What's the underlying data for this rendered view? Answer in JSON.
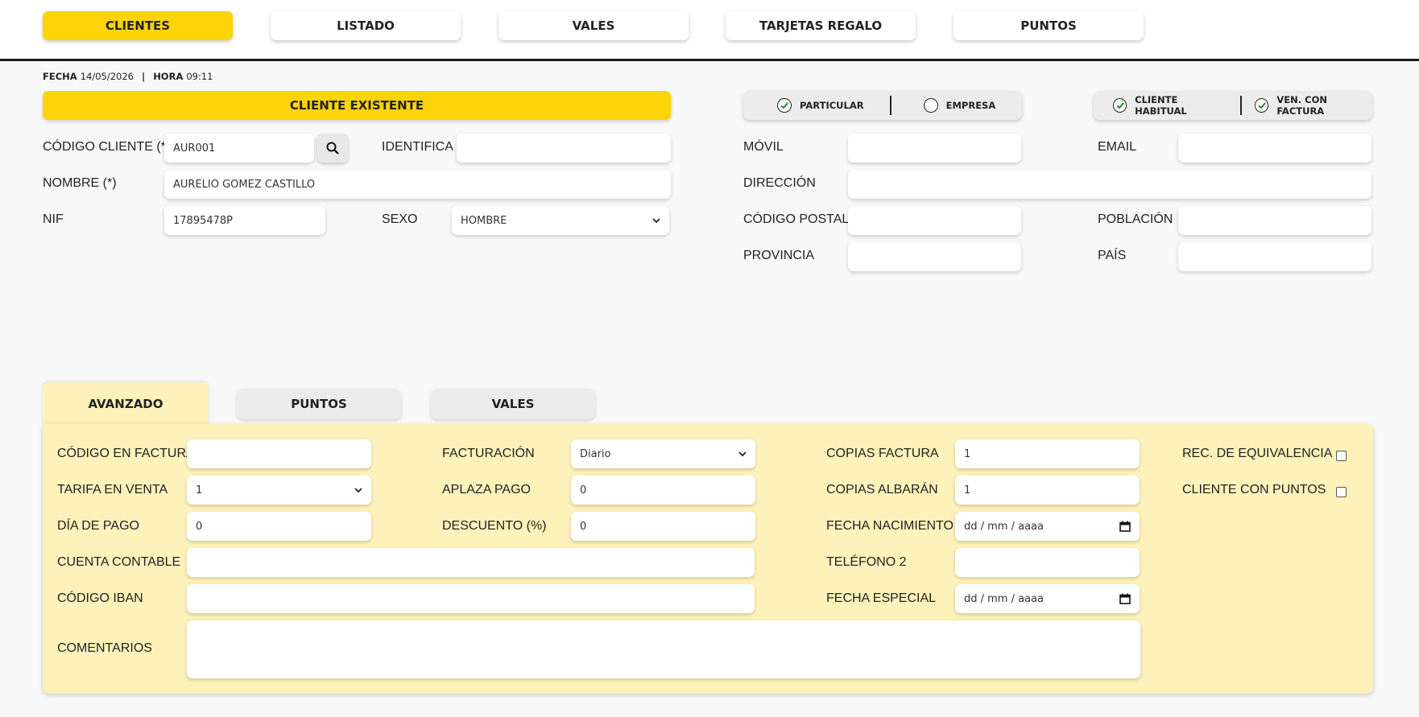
{
  "nav": {
    "tabs": [
      "CLIENTES",
      "LISTADO",
      "VALES",
      "TARJETAS REGALO",
      "PUNTOS"
    ],
    "active": "CLIENTES"
  },
  "datetime": {
    "fecha_label": "FECHA",
    "fecha": "14/05/2026",
    "hora_label": "HORA",
    "hora": "09:11"
  },
  "status_bar": "CLIENTE EXISTENTE",
  "type_toggle": {
    "particular": "PARTICULAR",
    "particular_checked": true,
    "empresa": "EMPRESA",
    "empresa_checked": false
  },
  "flags_toggle": {
    "habitual": "CLIENTE HABITUAL",
    "habitual_checked": true,
    "factura": "VEN. CON FACTURA",
    "factura_checked": true
  },
  "form": {
    "codigo_cliente_label": "CÓDIGO CLIENTE (*)",
    "codigo_cliente": "AUR001",
    "identifica_label": "IDENTIFICA",
    "identifica": "",
    "nombre_label": "NOMBRE (*)",
    "nombre": "AURELIO GOMEZ CASTILLO",
    "nif_label": "NIF",
    "nif": "17895478P",
    "sexo_label": "SEXO",
    "sexo": "HOMBRE",
    "movil_label": "MÓVIL",
    "movil": "",
    "email_label": "EMAIL",
    "email": "",
    "direccion_label": "DIRECCIÓN",
    "direccion": "",
    "cp_label": "CÓDIGO POSTAL",
    "cp": "",
    "poblacion_label": "POBLACIÓN",
    "poblacion": "",
    "provincia_label": "PROVINCIA",
    "provincia": "",
    "pais_label": "PAÍS",
    "pais": ""
  },
  "sub_tabs": [
    "AVANZADO",
    "PUNTOS",
    "VALES"
  ],
  "advanced": {
    "codigo_factura_label": "CÓDIGO EN FACTURA",
    "codigo_factura": "",
    "facturacion_label": "FACTURACIÓN",
    "facturacion": "Diario",
    "copias_factura_label": "COPIAS FACTURA",
    "copias_factura": "1",
    "rec_equiv_label": "REC. DE EQUIVALENCIA",
    "tarifa_label": "TARIFA EN VENTA",
    "tarifa": "1",
    "aplaza_label": "APLAZA PAGO",
    "aplaza": "0",
    "copias_albaran_label": "COPIAS ALBARÁN",
    "copias_albaran": "1",
    "con_puntos_label": "CLIENTE CON PUNTOS",
    "dia_pago_label": "DÍA DE PAGO",
    "dia_pago": "0",
    "descuento_label": "DESCUENTO (%)",
    "descuento": "0",
    "fecha_nac_label": "FECHA NACIMIENTO",
    "fecha_nac": "dd / mm / aaaa",
    "cuenta_label": "CUENTA CONTABLE",
    "cuenta": "",
    "telefono2_label": "TELÉFONO 2",
    "telefono2": "",
    "iban_label": "CÓDIGO IBAN",
    "iban": "",
    "fecha_esp_label": "FECHA ESPECIAL",
    "fecha_esp": "dd / mm / aaaa",
    "comentarios_label": "COMENTARIOS",
    "comentarios": ""
  }
}
